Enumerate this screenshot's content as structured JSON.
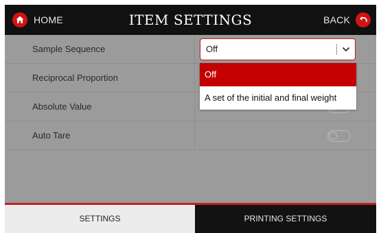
{
  "header": {
    "home_label": "HOME",
    "title": "ITEM SETTINGS",
    "back_label": "BACK",
    "home_icon": "home-icon",
    "back_icon": "back-arrow-icon",
    "accent_color": "#d01414"
  },
  "settings": {
    "rows": [
      {
        "label": "Sample Sequence",
        "control": "select",
        "value": "Off"
      },
      {
        "label": "Reciprocal Proportion",
        "control": "toggle",
        "value": "off"
      },
      {
        "label": "Absolute Value",
        "control": "toggle",
        "value": "off"
      },
      {
        "label": "Auto Tare",
        "control": "toggle",
        "value": "off"
      }
    ]
  },
  "dropdown": {
    "open": true,
    "options": [
      "Off",
      "A set of the initial and final weight"
    ],
    "selected_index": 0,
    "selected_color": "#c40000"
  },
  "tabs": [
    {
      "label": "SETTINGS",
      "active": true
    },
    {
      "label": "PRINTING SETTINGS",
      "active": false
    }
  ]
}
